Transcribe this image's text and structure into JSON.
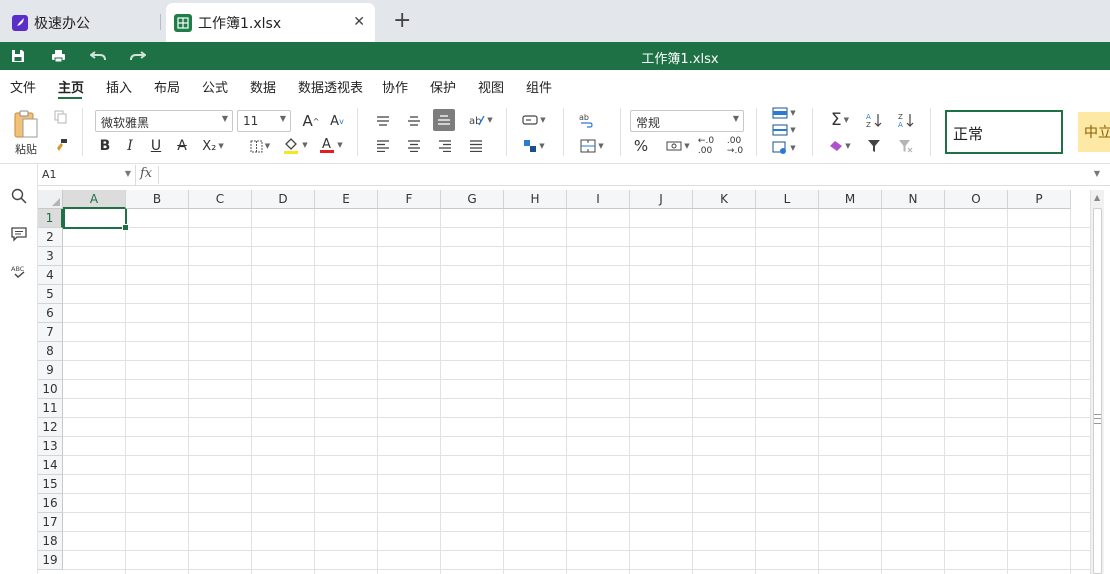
{
  "tabs": {
    "home": {
      "label": "极速办公"
    },
    "active": {
      "label": "工作簿1.xlsx"
    },
    "add_glyph": "+",
    "close_glyph": "✕"
  },
  "titlebar": {
    "title": "工作簿1.xlsx"
  },
  "menu": {
    "items": [
      "文件",
      "主页",
      "插入",
      "布局",
      "公式",
      "数据",
      "数据透视表",
      "协作",
      "保护",
      "视图",
      "组件"
    ],
    "active_index": 1
  },
  "ribbon": {
    "paste_label": "粘贴",
    "font_name": "微软雅黑",
    "font_size": "11",
    "number_format": "常规",
    "style_normal": "正常",
    "style_neutral": "中立",
    "bold": "B",
    "italic": "I",
    "underline": "U",
    "strike": "A",
    "subscript": "X₂",
    "percent": "%",
    "sigma": "Σ"
  },
  "formula_bar": {
    "cell_ref": "A1",
    "fx": "fx",
    "value": ""
  },
  "grid": {
    "columns": [
      "A",
      "B",
      "C",
      "D",
      "E",
      "F",
      "G",
      "H",
      "I",
      "J",
      "K",
      "L",
      "M",
      "N",
      "O",
      "P"
    ],
    "rows": [
      "1",
      "2",
      "3",
      "4",
      "5",
      "6",
      "7",
      "8",
      "9",
      "10",
      "11",
      "12",
      "13",
      "14",
      "15",
      "16",
      "17",
      "18",
      "19"
    ],
    "active_cell": "A1"
  },
  "colors": {
    "brand": "#1e7145",
    "neutral_style_bg": "#fde9a3",
    "tab_icon_purple": "#5a2ec8"
  }
}
